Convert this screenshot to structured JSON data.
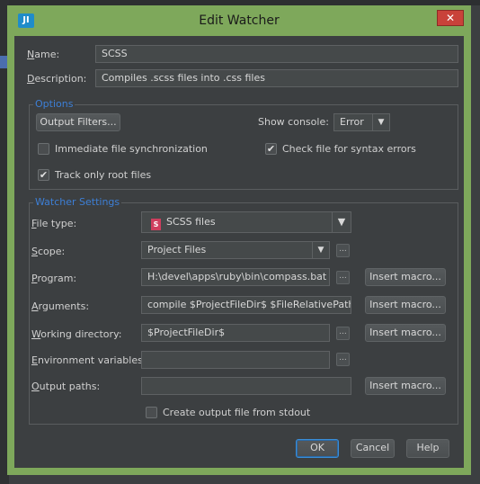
{
  "dialog": {
    "title": "Edit Watcher",
    "app_icon_text": "JI",
    "close_glyph": "✕"
  },
  "form": {
    "name": {
      "label_hot": "N",
      "label_rest": "ame:",
      "value": "SCSS"
    },
    "description": {
      "label_hot": "D",
      "label_rest": "escription:",
      "value": "Compiles .scss files into .css files"
    }
  },
  "options": {
    "title": "Options",
    "output_filters_label": "Output Filters...",
    "show_console_label": "Show console:",
    "show_console_value": "Error",
    "immediate_sync": {
      "label": "Immediate file synchronization",
      "checked": false
    },
    "check_syntax": {
      "label": "Check file for syntax errors",
      "checked": true
    },
    "track_root": {
      "label": "Track only root files",
      "checked": true
    }
  },
  "watcher": {
    "title": "Watcher Settings",
    "file_type": {
      "label_hot": "F",
      "label_rest": "ile type:",
      "value": "SCSS files",
      "icon_text": "S"
    },
    "scope": {
      "label_hot": "S",
      "label_rest": "cope:",
      "value": "Project Files"
    },
    "program": {
      "label_hot": "P",
      "label_rest": "rogram:",
      "value": "H:\\devel\\apps\\ruby\\bin\\compass.bat"
    },
    "arguments": {
      "label_hot": "A",
      "label_rest": "rguments:",
      "value": "compile $ProjectFileDir$ $FileRelativePath$"
    },
    "working_dir": {
      "label_hot": "W",
      "label_rest": "orking directory:",
      "value": "$ProjectFileDir$"
    },
    "env_vars": {
      "label_hot": "E",
      "label_rest": "nvironment variables:",
      "value": ""
    },
    "output_paths": {
      "label_hot": "O",
      "label_rest": "utput paths:",
      "value": ""
    },
    "create_output": {
      "label": "Create output file from stdout",
      "checked": false
    },
    "insert_macro_label": "Insert macro...",
    "dots_label": "..."
  },
  "footer": {
    "ok": "OK",
    "cancel": "Cancel",
    "help": "Help"
  },
  "colors": {
    "frame": "#7ea85b",
    "background": "#3c3f41",
    "group_title": "#3d7fd6",
    "close": "#c9423a"
  }
}
